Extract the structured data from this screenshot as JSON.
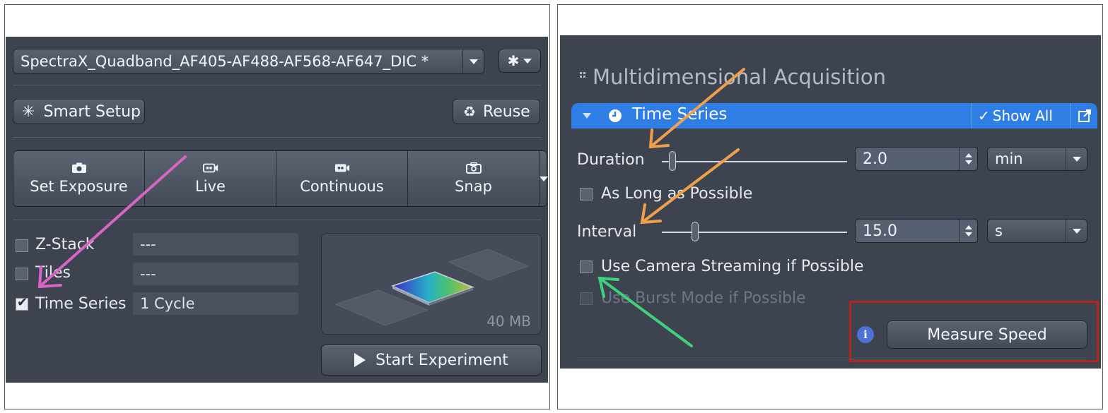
{
  "left_panel": {
    "preset_value": "SpectraX_Quadband_AF405-AF488-AF568-AF647_DIC *",
    "settings_icon": "gear-icon",
    "smart_setup_label": "Smart Setup",
    "reuse_label": "Reuse",
    "modes": [
      {
        "label": "Set Exposure",
        "icon": "camera-icon"
      },
      {
        "label": "Live",
        "icon": "video-camera-icon"
      },
      {
        "label": "Continuous",
        "icon": "video-camera-icon"
      },
      {
        "label": "Snap",
        "icon": "camera-outline-icon"
      }
    ],
    "dimensions": [
      {
        "label": "Z-Stack",
        "value": "---",
        "checked": false
      },
      {
        "label": "Tiles",
        "value": "---",
        "checked": false
      },
      {
        "label": "Time Series",
        "value": "1 Cycle",
        "checked": true
      }
    ],
    "preview_size": "40 MB",
    "start_label": "Start Experiment"
  },
  "right_panel": {
    "title": "Multidimensional Acquisition",
    "section_title": "Time Series",
    "show_all_label": "Show All",
    "duration": {
      "label": "Duration",
      "value": "2.0",
      "unit": "min",
      "slider_fraction": 0.05
    },
    "as_long_as_possible_label": "As Long as Possible",
    "interval": {
      "label": "Interval",
      "value": "15.0",
      "unit": "s",
      "slider_fraction": 0.18
    },
    "camera_streaming_label": "Use Camera Streaming if Possible",
    "burst_mode_label": "Use Burst Mode if Possible",
    "measure_speed_label": "Measure Speed"
  },
  "colors": {
    "panel_bg": "#3d4450",
    "section_accent": "#2f7ee6",
    "arrow_magenta": "#d865c6",
    "arrow_orange": "#f0a04b",
    "arrow_green": "#3fd07a",
    "highlight_red": "#b4261a"
  }
}
